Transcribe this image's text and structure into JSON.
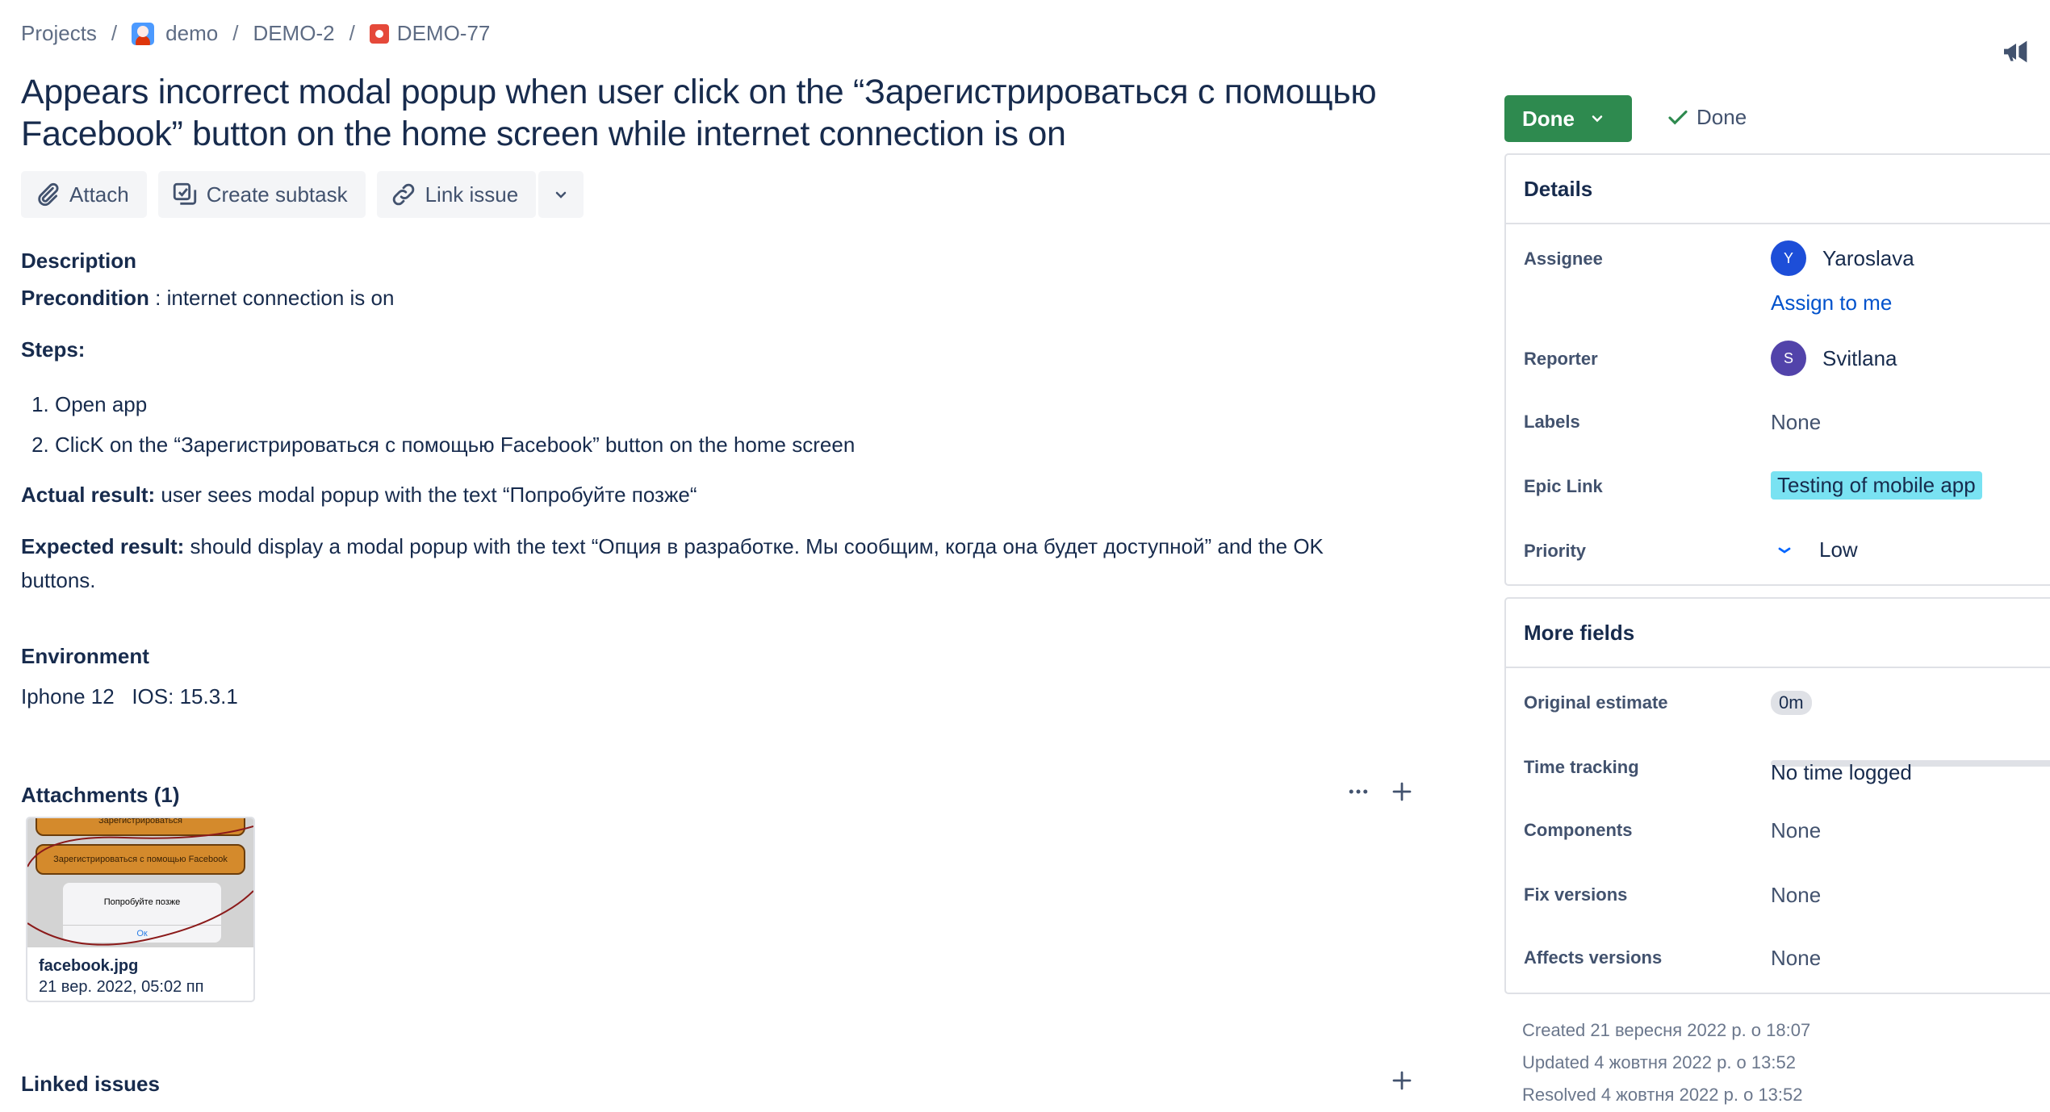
{
  "breadcrumb": {
    "projects": "Projects",
    "sep": "/",
    "project": "demo",
    "parent": "DEMO-2",
    "issue_key": "DEMO-77"
  },
  "issue": {
    "title": "Appears incorrect modal popup when user click on the “Зарегистрироваться с помощью Facebook” button on the home screen while internet connection is on"
  },
  "actions": {
    "attach": "Attach",
    "create_subtask": "Create subtask",
    "link_issue": "Link issue"
  },
  "description": {
    "heading": "Description",
    "precondition_label": "Precondition",
    "precondition_text": " : internet connection is on",
    "steps_label": "Steps:",
    "steps": [
      "Open app",
      "ClicK on the “Зарегистрироваться с помощью Facebook” button on the home screen"
    ],
    "actual_label": "Actual result:",
    "actual_text": " user sees modal popup with the text “Попробуйте позже“",
    "expected_label": "Expected result:",
    "expected_text_1": " should display a modal popup with the text “Опция в разработке. Мы сообщим, когда она будет доступной” and the OK",
    "expected_text_2": "buttons."
  },
  "environment": {
    "heading": "Environment",
    "text": "Iphone 12   IOS: 15.3.1"
  },
  "attachments": {
    "heading": "Attachments (1)",
    "files": [
      {
        "name": "facebook.jpg",
        "date": "21 вер. 2022, 05:02 пп",
        "thumb_top_text": "Зарегистрироваться",
        "thumb_button_text": "Зарегистрироваться с помощью Facebook",
        "thumb_dialog_text": "Попробуйте позже",
        "thumb_ok_text": "Ок"
      }
    ]
  },
  "linked_issues": {
    "heading": "Linked issues"
  },
  "status": {
    "label": "Done",
    "resolution": "Done",
    "color": "#2e8a4f"
  },
  "details": {
    "heading": "Details",
    "assignee_label": "Assignee",
    "assignee_initial": "Y",
    "assignee_name": "Yaroslava",
    "assign_to_me": "Assign to me",
    "reporter_label": "Reporter",
    "reporter_initial": "S",
    "reporter_name": "Svitlana",
    "labels_label": "Labels",
    "labels_value": "None",
    "epic_label": "Epic Link",
    "epic_value": "Testing of mobile app",
    "priority_label": "Priority",
    "priority_value": "Low"
  },
  "more_fields": {
    "heading": "More fields",
    "estimate_label": "Original estimate",
    "estimate_value": "0m",
    "tracking_label": "Time tracking",
    "tracking_value": "No time logged",
    "components_label": "Components",
    "components_value": "None",
    "fix_label": "Fix versions",
    "fix_value": "None",
    "affects_label": "Affects versions",
    "affects_value": "None"
  },
  "meta": {
    "created": "Created 21 вересня 2022 р. о 18:07",
    "updated": "Updated 4 жовтня 2022 р. о 13:52",
    "resolved": "Resolved 4 жовтня 2022 р. о 13:52"
  },
  "colors": {
    "accent": "#0052cc",
    "assignee_avatar": "#1d4ed8",
    "reporter_avatar": "#5243aa",
    "epic": "#79e2f2"
  },
  "icons": [
    "project-avatar-icon",
    "bug-icon",
    "megaphone-icon",
    "paperclip-icon",
    "subtask-icon",
    "link-icon",
    "chevron-down-icon",
    "check-icon",
    "more-icon",
    "plus-icon",
    "priority-low-icon"
  ]
}
